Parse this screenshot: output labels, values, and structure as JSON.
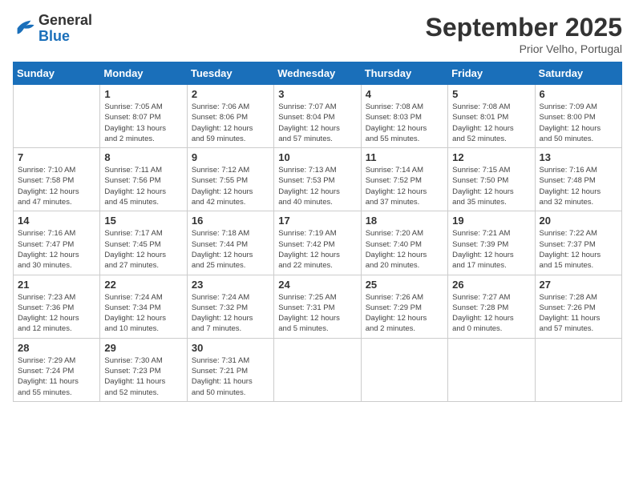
{
  "logo": {
    "general": "General",
    "blue": "Blue"
  },
  "title": "September 2025",
  "subtitle": "Prior Velho, Portugal",
  "days_of_week": [
    "Sunday",
    "Monday",
    "Tuesday",
    "Wednesday",
    "Thursday",
    "Friday",
    "Saturday"
  ],
  "weeks": [
    [
      {
        "day": "",
        "info": ""
      },
      {
        "day": "1",
        "info": "Sunrise: 7:05 AM\nSunset: 8:07 PM\nDaylight: 13 hours\nand 2 minutes."
      },
      {
        "day": "2",
        "info": "Sunrise: 7:06 AM\nSunset: 8:06 PM\nDaylight: 12 hours\nand 59 minutes."
      },
      {
        "day": "3",
        "info": "Sunrise: 7:07 AM\nSunset: 8:04 PM\nDaylight: 12 hours\nand 57 minutes."
      },
      {
        "day": "4",
        "info": "Sunrise: 7:08 AM\nSunset: 8:03 PM\nDaylight: 12 hours\nand 55 minutes."
      },
      {
        "day": "5",
        "info": "Sunrise: 7:08 AM\nSunset: 8:01 PM\nDaylight: 12 hours\nand 52 minutes."
      },
      {
        "day": "6",
        "info": "Sunrise: 7:09 AM\nSunset: 8:00 PM\nDaylight: 12 hours\nand 50 minutes."
      }
    ],
    [
      {
        "day": "7",
        "info": "Sunrise: 7:10 AM\nSunset: 7:58 PM\nDaylight: 12 hours\nand 47 minutes."
      },
      {
        "day": "8",
        "info": "Sunrise: 7:11 AM\nSunset: 7:56 PM\nDaylight: 12 hours\nand 45 minutes."
      },
      {
        "day": "9",
        "info": "Sunrise: 7:12 AM\nSunset: 7:55 PM\nDaylight: 12 hours\nand 42 minutes."
      },
      {
        "day": "10",
        "info": "Sunrise: 7:13 AM\nSunset: 7:53 PM\nDaylight: 12 hours\nand 40 minutes."
      },
      {
        "day": "11",
        "info": "Sunrise: 7:14 AM\nSunset: 7:52 PM\nDaylight: 12 hours\nand 37 minutes."
      },
      {
        "day": "12",
        "info": "Sunrise: 7:15 AM\nSunset: 7:50 PM\nDaylight: 12 hours\nand 35 minutes."
      },
      {
        "day": "13",
        "info": "Sunrise: 7:16 AM\nSunset: 7:48 PM\nDaylight: 12 hours\nand 32 minutes."
      }
    ],
    [
      {
        "day": "14",
        "info": "Sunrise: 7:16 AM\nSunset: 7:47 PM\nDaylight: 12 hours\nand 30 minutes."
      },
      {
        "day": "15",
        "info": "Sunrise: 7:17 AM\nSunset: 7:45 PM\nDaylight: 12 hours\nand 27 minutes."
      },
      {
        "day": "16",
        "info": "Sunrise: 7:18 AM\nSunset: 7:44 PM\nDaylight: 12 hours\nand 25 minutes."
      },
      {
        "day": "17",
        "info": "Sunrise: 7:19 AM\nSunset: 7:42 PM\nDaylight: 12 hours\nand 22 minutes."
      },
      {
        "day": "18",
        "info": "Sunrise: 7:20 AM\nSunset: 7:40 PM\nDaylight: 12 hours\nand 20 minutes."
      },
      {
        "day": "19",
        "info": "Sunrise: 7:21 AM\nSunset: 7:39 PM\nDaylight: 12 hours\nand 17 minutes."
      },
      {
        "day": "20",
        "info": "Sunrise: 7:22 AM\nSunset: 7:37 PM\nDaylight: 12 hours\nand 15 minutes."
      }
    ],
    [
      {
        "day": "21",
        "info": "Sunrise: 7:23 AM\nSunset: 7:36 PM\nDaylight: 12 hours\nand 12 minutes."
      },
      {
        "day": "22",
        "info": "Sunrise: 7:24 AM\nSunset: 7:34 PM\nDaylight: 12 hours\nand 10 minutes."
      },
      {
        "day": "23",
        "info": "Sunrise: 7:24 AM\nSunset: 7:32 PM\nDaylight: 12 hours\nand 7 minutes."
      },
      {
        "day": "24",
        "info": "Sunrise: 7:25 AM\nSunset: 7:31 PM\nDaylight: 12 hours\nand 5 minutes."
      },
      {
        "day": "25",
        "info": "Sunrise: 7:26 AM\nSunset: 7:29 PM\nDaylight: 12 hours\nand 2 minutes."
      },
      {
        "day": "26",
        "info": "Sunrise: 7:27 AM\nSunset: 7:28 PM\nDaylight: 12 hours\nand 0 minutes."
      },
      {
        "day": "27",
        "info": "Sunrise: 7:28 AM\nSunset: 7:26 PM\nDaylight: 11 hours\nand 57 minutes."
      }
    ],
    [
      {
        "day": "28",
        "info": "Sunrise: 7:29 AM\nSunset: 7:24 PM\nDaylight: 11 hours\nand 55 minutes."
      },
      {
        "day": "29",
        "info": "Sunrise: 7:30 AM\nSunset: 7:23 PM\nDaylight: 11 hours\nand 52 minutes."
      },
      {
        "day": "30",
        "info": "Sunrise: 7:31 AM\nSunset: 7:21 PM\nDaylight: 11 hours\nand 50 minutes."
      },
      {
        "day": "",
        "info": ""
      },
      {
        "day": "",
        "info": ""
      },
      {
        "day": "",
        "info": ""
      },
      {
        "day": "",
        "info": ""
      }
    ]
  ]
}
